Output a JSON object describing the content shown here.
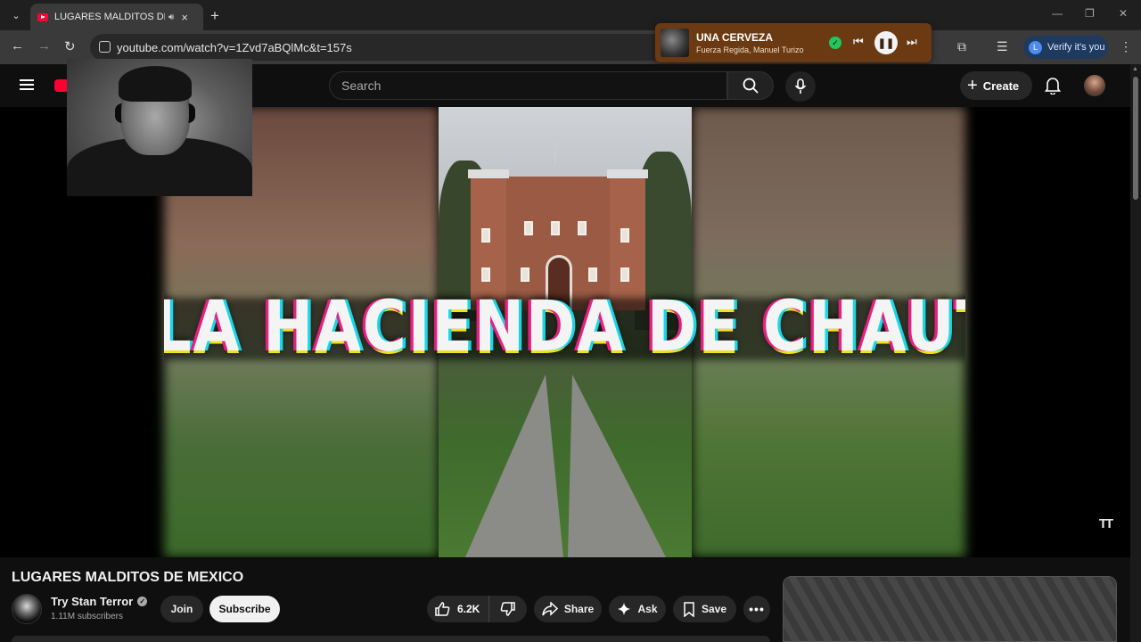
{
  "browser": {
    "tab": {
      "title": "LUGARES MALDITOS DE MEXICO",
      "audio_icon": "speaker-icon",
      "close_icon": "close-icon"
    },
    "url": "youtube.com/watch?v=1Zvd7aBQlMc&t=157s",
    "verify_label": "Verify it's you",
    "verify_badge": "L"
  },
  "media_popup": {
    "song": "UNA CERVEZA",
    "artist": "Fuerza Regida, Manuel Turizo",
    "state": "playing"
  },
  "youtube_header": {
    "search_placeholder": "Search",
    "create_label": "Create"
  },
  "video": {
    "overlay_title": "LA HACIENDA DE CHAUTLA",
    "cc_label": "TT"
  },
  "below_video": {
    "title": "LUGARES MALDITOS DE MEXICO",
    "channel_name": "Try Stan Terror",
    "subscribers": "1.11M subscribers",
    "join_label": "Join",
    "subscribe_label": "Subscribe",
    "like_count": "6.2K",
    "share_label": "Share",
    "ask_label": "Ask",
    "save_label": "Save"
  },
  "colors": {
    "youtube_red": "#ff0033",
    "page_bg": "#0f0f0f",
    "pill_bg": "#272727",
    "media_popup_bg": "#6b3a12",
    "verify_bg": "#1e3a5f"
  }
}
